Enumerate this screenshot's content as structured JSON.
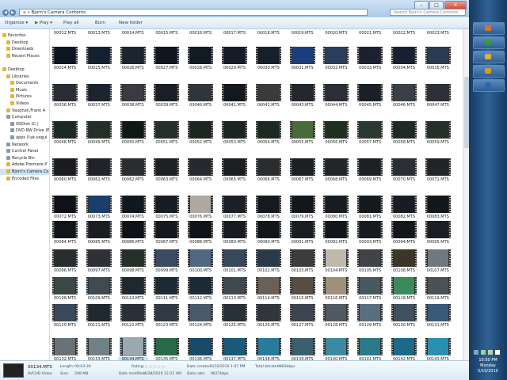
{
  "window": {
    "breadcrumb": "Bjorn's Camera Contents",
    "search_placeholder": "Search Bjorn's Camera Contents"
  },
  "toolbar": {
    "organize": "Organize ▾",
    "play": "Play ▾",
    "play_all": "Play all",
    "burn": "Burn",
    "new_folder": "New folder"
  },
  "nav": [
    {
      "label": "Favorites",
      "kind": "star",
      "indent": 0
    },
    {
      "label": "Desktop",
      "kind": "folder",
      "indent": 1
    },
    {
      "label": "Downloads",
      "kind": "folder",
      "indent": 1
    },
    {
      "label": "Recent Places",
      "kind": "folder",
      "indent": 1
    },
    {
      "label": "",
      "kind": "",
      "indent": 0
    },
    {
      "label": "Desktop",
      "kind": "folder",
      "indent": 0
    },
    {
      "label": "Libraries",
      "kind": "folder",
      "indent": 1
    },
    {
      "label": "Documents",
      "kind": "folder",
      "indent": 2
    },
    {
      "label": "Music",
      "kind": "folder",
      "indent": 2
    },
    {
      "label": "Pictures",
      "kind": "folder",
      "indent": 2
    },
    {
      "label": "Videos",
      "kind": "folder",
      "indent": 2
    },
    {
      "label": "Vaughan,Frank A",
      "kind": "folder",
      "indent": 1
    },
    {
      "label": "Computer",
      "kind": "drive",
      "indent": 1
    },
    {
      "label": "OSDisk (C:)",
      "kind": "drive",
      "indent": 2
    },
    {
      "label": "DVD RW Drive (E",
      "kind": "drive",
      "indent": 2
    },
    {
      "label": "apps (\\\\at-vegul",
      "kind": "drive",
      "indent": 2
    },
    {
      "label": "Network",
      "kind": "drive",
      "indent": 1
    },
    {
      "label": "Control Panel",
      "kind": "drive",
      "indent": 1
    },
    {
      "label": "Recycle Bin",
      "kind": "drive",
      "indent": 1
    },
    {
      "label": "Adobe Premiere P",
      "kind": "folder",
      "indent": 1
    },
    {
      "label": "Bjorn's Camera Co",
      "kind": "folder",
      "indent": 1,
      "selected": true
    },
    {
      "label": "Encoded Files",
      "kind": "folder",
      "indent": 1
    }
  ],
  "top_row_labels": [
    "00012.MTS",
    "00013.MTS",
    "00014.MTS",
    "00015.MTS",
    "00016.MTS",
    "00017.MTS",
    "00018.MTS",
    "00019.MTS",
    "00020.MTS",
    "00021.MTS",
    "00022.MTS",
    "00023.MTS"
  ],
  "rows": [
    [
      "00024.MTS",
      "00025.MTS",
      "00026.MTS",
      "00027.MTS",
      "00028.MTS",
      "00029.MTS",
      "00030.MTS",
      "00031.MTS",
      "00032.MTS",
      "00033.MTS",
      "00034.MTS",
      "00035.MTS"
    ],
    [
      "00036.MTS",
      "00037.MTS",
      "00038.MTS",
      "00039.MTS",
      "00040.MTS",
      "00041.MTS",
      "00042.MTS",
      "00043.MTS",
      "00044.MTS",
      "00045.MTS",
      "00046.MTS",
      "00047.MTS"
    ],
    [
      "00048.MTS",
      "00049.MTS",
      "00050.MTS",
      "00051.MTS",
      "00052.MTS",
      "00053.MTS",
      "00054.MTS",
      "00055.MTS",
      "00056.MTS",
      "00057.MTS",
      "00058.MTS",
      "00059.MTS"
    ],
    [
      "00060.MTS",
      "00061.MTS",
      "00062.MTS",
      "00063.MTS",
      "00064.MTS",
      "00065.MTS",
      "00066.MTS",
      "00067.MTS",
      "00068.MTS",
      "00069.MTS",
      "00070.MTS",
      "00071.MTS"
    ],
    [
      "00072.MTS",
      "00073.MTS",
      "00074.MTS",
      "00075.MTS",
      "00076.MTS",
      "00077.MTS",
      "00078.MTS",
      "00079.MTS",
      "00080.MTS",
      "00081.MTS",
      "00082.MTS",
      "00083.MTS"
    ],
    [
      "00084.MTS",
      "00085.MTS",
      "00086.MTS",
      "00087.MTS",
      "00088.MTS",
      "00089.MTS",
      "00090.MTS",
      "00091.MTS",
      "00092.MTS",
      "00093.MTS",
      "00094.MTS",
      "00095.MTS"
    ],
    [
      "00096.MTS",
      "00097.MTS",
      "00098.MTS",
      "00099.MTS",
      "00100.MTS",
      "00101.MTS",
      "00102.MTS",
      "00103.MTS",
      "00104.MTS",
      "00105.MTS",
      "00106.MTS",
      "00107.MTS"
    ],
    [
      "00108.MTS",
      "00109.MTS",
      "00110.MTS",
      "00111.MTS",
      "00112.MTS",
      "00113.MTS",
      "00114.MTS",
      "00115.MTS",
      "00116.MTS",
      "00117.MTS",
      "00118.MTS",
      "00119.MTS"
    ],
    [
      "00120.MTS",
      "00121.MTS",
      "00122.MTS",
      "00123.MTS",
      "00124.MTS",
      "00125.MTS",
      "00126.MTS",
      "00127.MTS",
      "00128.MTS",
      "00129.MTS",
      "00130.MTS",
      "00131.MTS"
    ],
    [
      "00132.MTS",
      "00133.MTS",
      "00134.MTS",
      "00135.MTS",
      "00136.MTS",
      "00137.MTS",
      "00138.MTS",
      "00139.MTS",
      "00140.MTS",
      "00141.MTS",
      "00142.MTS",
      "00143.MTS"
    ]
  ],
  "selected_file": "00134.MTS",
  "thumb_colors": [
    [
      "#0d1520",
      "#15202e",
      "#1c2430",
      "#10161d",
      "#121a24",
      "#141c28",
      "#16202b",
      "#1b3d7a",
      "#2a3d5a",
      "#1a2230",
      "#162030",
      "#2a3a50"
    ],
    [
      "#2a2d35",
      "#1d2430",
      "#3a3a42",
      "#1a1f28",
      "#30343c",
      "#141820",
      "#3c3a38",
      "#22272e",
      "#2b2e36",
      "#1b2028",
      "#3a3f48",
      "#2e3038"
    ],
    [
      "#1c2a24",
      "#223028",
      "#0d1a14",
      "#26302a",
      "#1e2620",
      "#1a2420",
      "#1c2a22",
      "#4a6a3a",
      "#203020",
      "#2a3a30",
      "#1e2a26",
      "#253029"
    ],
    [
      "#1a1c20",
      "#202428",
      "#2a2d30",
      "#1e2124",
      "#262a2e",
      "#1c1f22",
      "#2a2c2e",
      "#1d2023",
      "#232629",
      "#1e2124",
      "#2b2f33",
      "#222528"
    ],
    [
      "#0e1218",
      "#1a3e6a",
      "#121820",
      "#161c22",
      "#b0a8a0",
      "#1b2026",
      "#151a20",
      "#12171c",
      "#171c22",
      "#14191e",
      "#181d23",
      "#13181d"
    ],
    [
      "#111418",
      "#1a1e22",
      "#0f1216",
      "#15191d",
      "#101317",
      "#181c20",
      "#131619",
      "#1a1e22",
      "#121519",
      "#171b1f",
      "#14171b",
      "#1b1f23"
    ],
    [
      "#282d30",
      "#2e3236",
      "#243028",
      "#3a4a60",
      "#506880",
      "#38485a",
      "#2a3a48",
      "#3a3c3e",
      "#c0b8a8",
      "#404448",
      "#3c3628",
      "#707880"
    ],
    [
      "#3c4848",
      "#404a52",
      "#1e2830",
      "#1c2a34",
      "#1a2a36",
      "#404850",
      "#6a6058",
      "#584e44",
      "#a09078",
      "#485860",
      "#3a8a5a",
      "#4a5258"
    ],
    [
      "#3a4a5a",
      "#202830",
      "#2a3038",
      "#303a44",
      "#4a5a6a",
      "#283038",
      "#30363c",
      "#3c4650",
      "#505a60",
      "#5a6e80",
      "#40505e",
      "#3a5a7a"
    ],
    [
      "#6a7278",
      "#708088",
      "#9aa8b0",
      "#2a6a4a",
      "#1a4a6a",
      "#1a5a7a",
      "#2a7a9a",
      "#3a6070",
      "#3a8aa0",
      "#2a7a8a",
      "#1a6a88",
      "#2a90b0"
    ]
  ],
  "status": {
    "filename": "00134.MTS",
    "type": "AVCHD Video",
    "length_label": "Length:",
    "length": "00:03:30",
    "size_label": "Size:",
    "size": "248 MB",
    "rating_label": "Rating:",
    "rating_stars": "☆☆☆☆☆",
    "date_modified_label": "Date modified:",
    "date_modified": "4/28/2010 12:21 AM",
    "date_created_label": "Date created:",
    "date_created": "5/10/2010 1:07 PM",
    "data_rate_label": "Data rate:",
    "data_rate": "9627kbps",
    "total_bitrate_label": "Total bitrate:",
    "total_bitrate": "9883kbps"
  },
  "taskbar": {
    "time": "10:50 PM",
    "day": "Monday",
    "date": "5/10/2010",
    "button_colors": [
      "#e07020",
      "#3a9a3a",
      "#e0b030",
      "#d0a020",
      "#2a6ab0"
    ]
  }
}
